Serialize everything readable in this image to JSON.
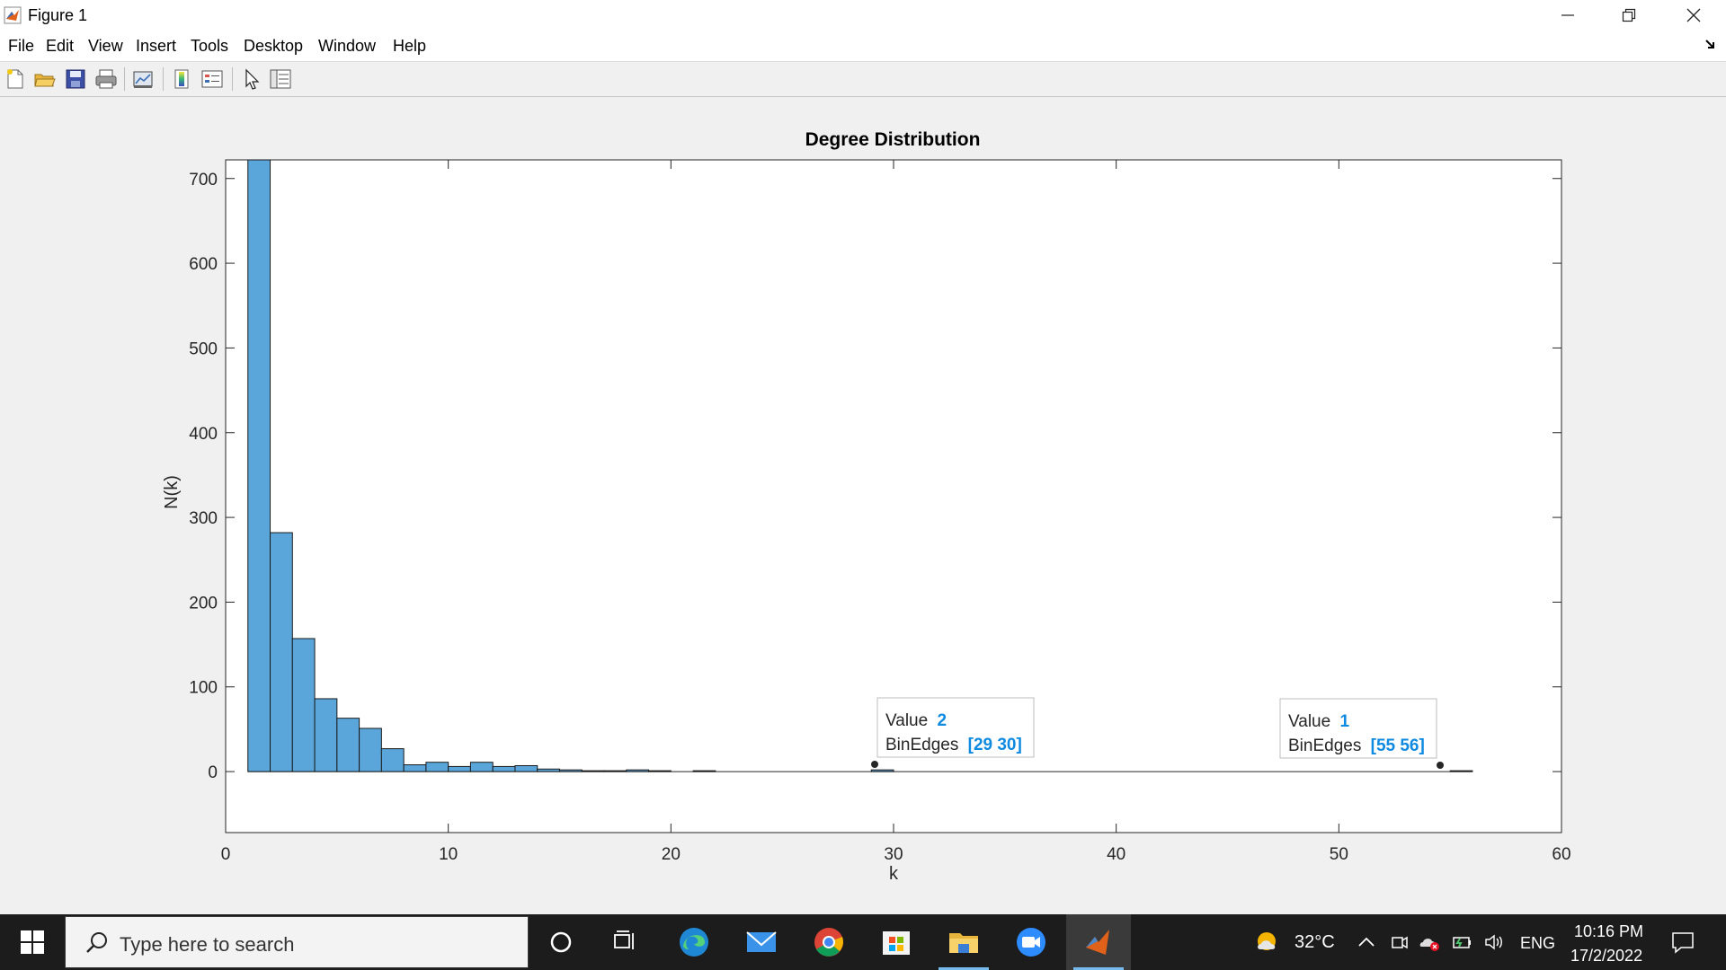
{
  "window": {
    "title": "Figure 1",
    "controls": [
      "minimize",
      "restore",
      "close"
    ]
  },
  "menu": {
    "items": [
      "File",
      "Edit",
      "View",
      "Insert",
      "Tools",
      "Desktop",
      "Window",
      "Help"
    ]
  },
  "toolbar": {
    "icons": [
      "new-figure-icon",
      "open-file-icon",
      "save-icon",
      "print-icon",
      "link-plot-icon",
      "insert-colorbar-icon",
      "insert-legend-icon",
      "edit-plot-icon",
      "property-inspector-icon"
    ]
  },
  "chart_data": {
    "type": "bar",
    "title": "Degree Distribution",
    "xlabel": "k",
    "ylabel": "N(k)",
    "xlim": [
      0,
      60
    ],
    "ylim": [
      -72,
      722
    ],
    "xticks": [
      0,
      10,
      20,
      30,
      40,
      50,
      60
    ],
    "yticks": [
      0,
      100,
      200,
      300,
      400,
      500,
      600,
      700
    ],
    "bin_width": 1,
    "bin_starts": [
      1,
      2,
      3,
      4,
      5,
      6,
      7,
      8,
      9,
      10,
      11,
      12,
      13,
      14,
      15,
      16,
      17,
      18,
      19,
      20,
      21,
      22,
      23,
      24,
      25,
      26,
      27,
      28,
      29,
      30,
      31,
      32,
      33,
      34,
      35,
      36,
      37,
      38,
      39,
      40,
      41,
      42,
      43,
      44,
      45,
      46,
      47,
      48,
      49,
      50,
      51,
      52,
      53,
      54,
      55
    ],
    "values": [
      722,
      282,
      157,
      86,
      63,
      51,
      27,
      8,
      11,
      6,
      11,
      6,
      7,
      3,
      2,
      1,
      1,
      2,
      1,
      0,
      1,
      0,
      0,
      0,
      0,
      0,
      0,
      0,
      2,
      0,
      0,
      0,
      0,
      0,
      0,
      0,
      0,
      0,
      0,
      0,
      0,
      0,
      0,
      0,
      0,
      0,
      0,
      0,
      0,
      0,
      0,
      0,
      0,
      0,
      1
    ],
    "bar_color": "#5aa5d9",
    "grid": false,
    "datatips": [
      {
        "value_label": "Value",
        "value": "2",
        "edges_label": "BinEdges",
        "edges": "[29 30]"
      },
      {
        "value_label": "Value",
        "value": "1",
        "edges_label": "BinEdges",
        "edges": "[55 56]"
      }
    ],
    "datatip_value_color": "#0072bd"
  },
  "taskbar": {
    "search_placeholder": "Type here to search",
    "apps": [
      "cortana-icon",
      "task-view-icon",
      "edge-icon",
      "mail-icon",
      "chrome-icon",
      "store-icon",
      "file-explorer-icon",
      "zoom-icon",
      "matlab-icon"
    ],
    "weather": "32°C",
    "language": "ENG",
    "time": "10:16 PM",
    "date": "17/2/2022"
  }
}
